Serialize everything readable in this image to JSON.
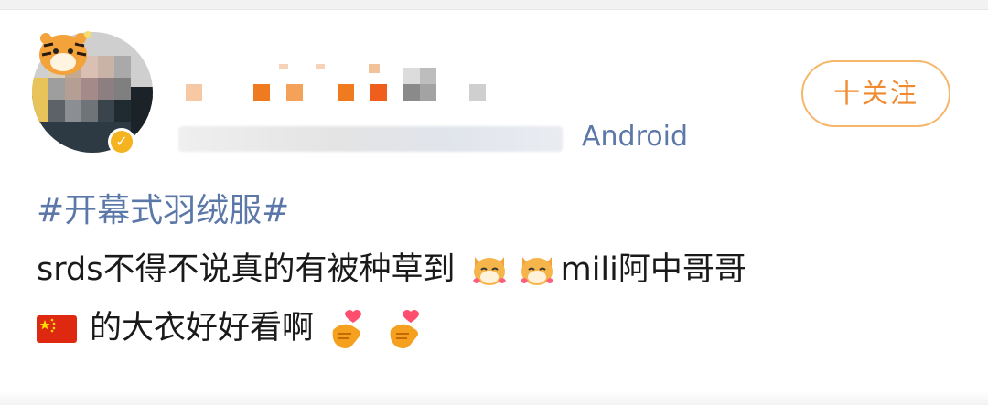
{
  "post": {
    "source": "Android",
    "follow_label": "十关注",
    "topic": "#开幕式羽绒服#",
    "line1_text": "srds不得不说真的有被种草到",
    "line1_tail": "mili阿中哥哥",
    "line2_text": "的大衣好好看啊"
  },
  "icons": {
    "avatar": "avatar-icon",
    "verify": "verified-badge-icon",
    "emoji_dog": "shiba-dog-emoji",
    "emoji_heart": "heart-hands-emoji",
    "flag": "china-flag-icon"
  },
  "colors": {
    "link_blue": "#5b78a8",
    "follow_orange": "#f08a2e",
    "follow_border": "#f6b66b",
    "text": "#1a1a1a"
  }
}
